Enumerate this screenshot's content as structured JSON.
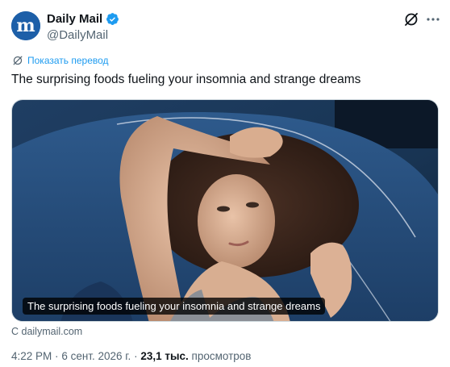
{
  "author": {
    "name": "Daily Mail",
    "handle": "@DailyMail",
    "avatar_letter": "m",
    "avatar_color": "#1d5fa8",
    "verified": true,
    "verified_color": "#1d9bf0"
  },
  "translate_label": "Показать перевод",
  "tweet_text": "The surprising foods fueling your insomnia and strange dreams",
  "card": {
    "caption": "The surprising foods fueling your insomnia and strange dreams",
    "source": "С dailymail.com"
  },
  "meta": {
    "time": "4:22 PM",
    "separator1": "·",
    "date": "6 сент. 2026 г.",
    "separator2": "·",
    "views_count": "23,1 тыс.",
    "views_label": "просмотров"
  },
  "icons": {
    "grok": "grok-icon",
    "more": "more-horizontal-icon",
    "translate": "translate-icon",
    "verified": "verified-badge-icon"
  },
  "colors": {
    "link": "#1d9bf0",
    "text": "#0f1419",
    "secondary": "#536471"
  }
}
